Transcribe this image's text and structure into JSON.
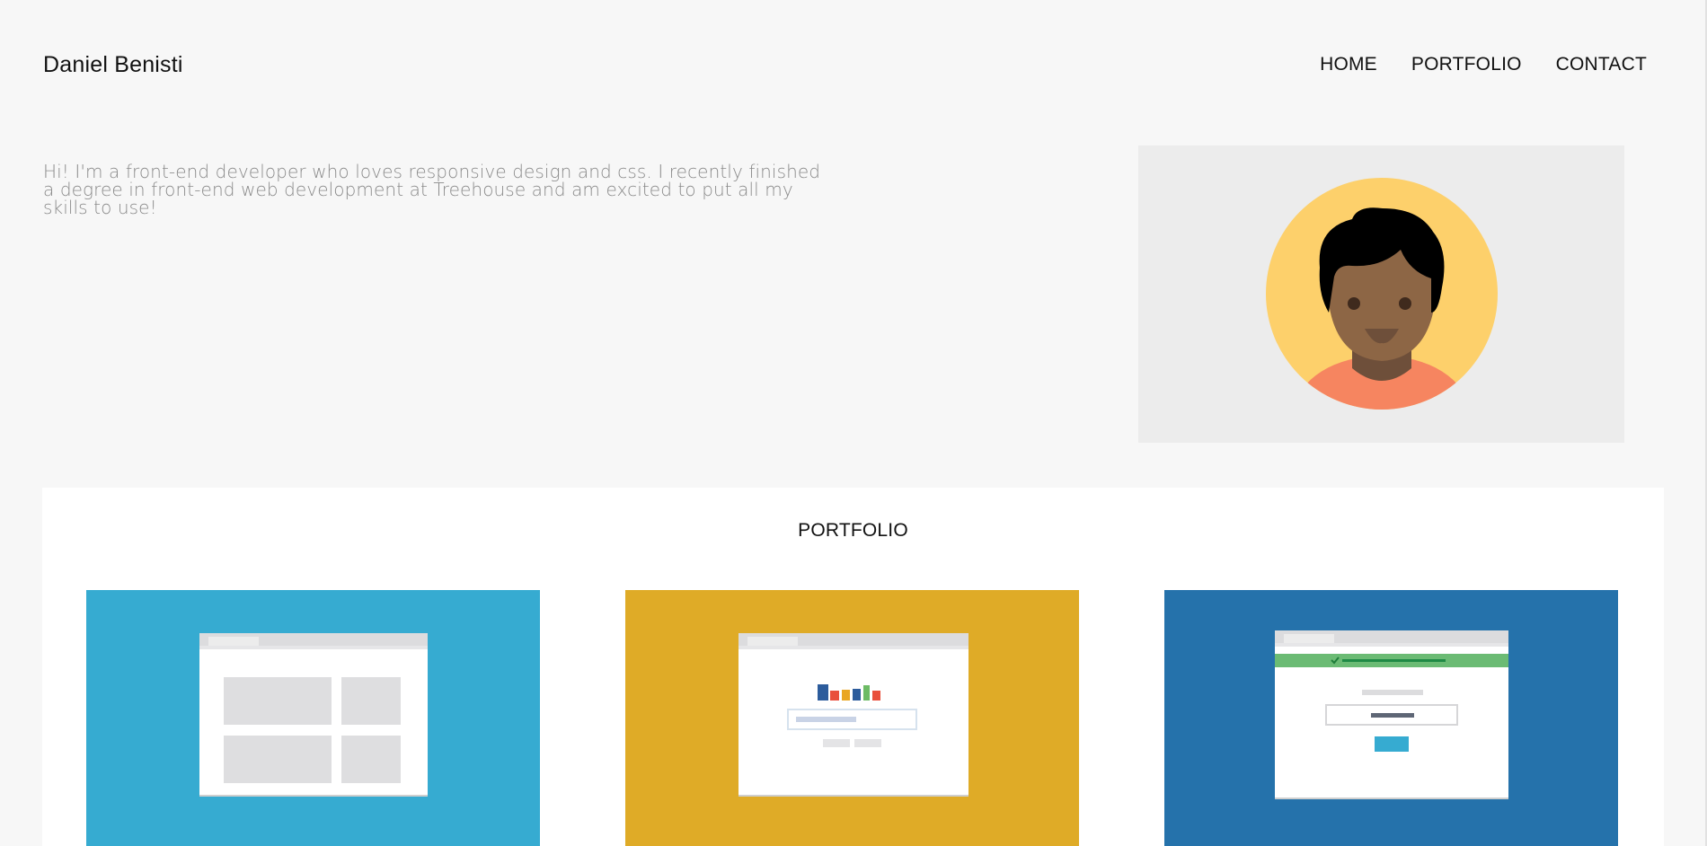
{
  "header": {
    "brand": "Daniel Benisti",
    "nav": [
      {
        "label": "HOME"
      },
      {
        "label": "PORTFOLIO"
      },
      {
        "label": "CONTACT"
      }
    ]
  },
  "intro": {
    "text": "Hi! I'm a front-end developer who loves responsive design and css. I recently finished a degree in front-end web development at Treehouse and am excited to put all my skills to use!"
  },
  "portfolio": {
    "heading": "PORTFOLIO",
    "projects": [
      {
        "icon": "layout-grid-illustration",
        "color": "#36abd1"
      },
      {
        "icon": "chart-search-illustration",
        "color": "#dfab27"
      },
      {
        "icon": "form-success-illustration",
        "color": "#2572ab"
      }
    ]
  },
  "colors": {
    "background": "#f7f7f7",
    "avatar_bg": "#ececec",
    "avatar_circle": "#fdd06b",
    "text_muted": "#8a8a8a"
  }
}
